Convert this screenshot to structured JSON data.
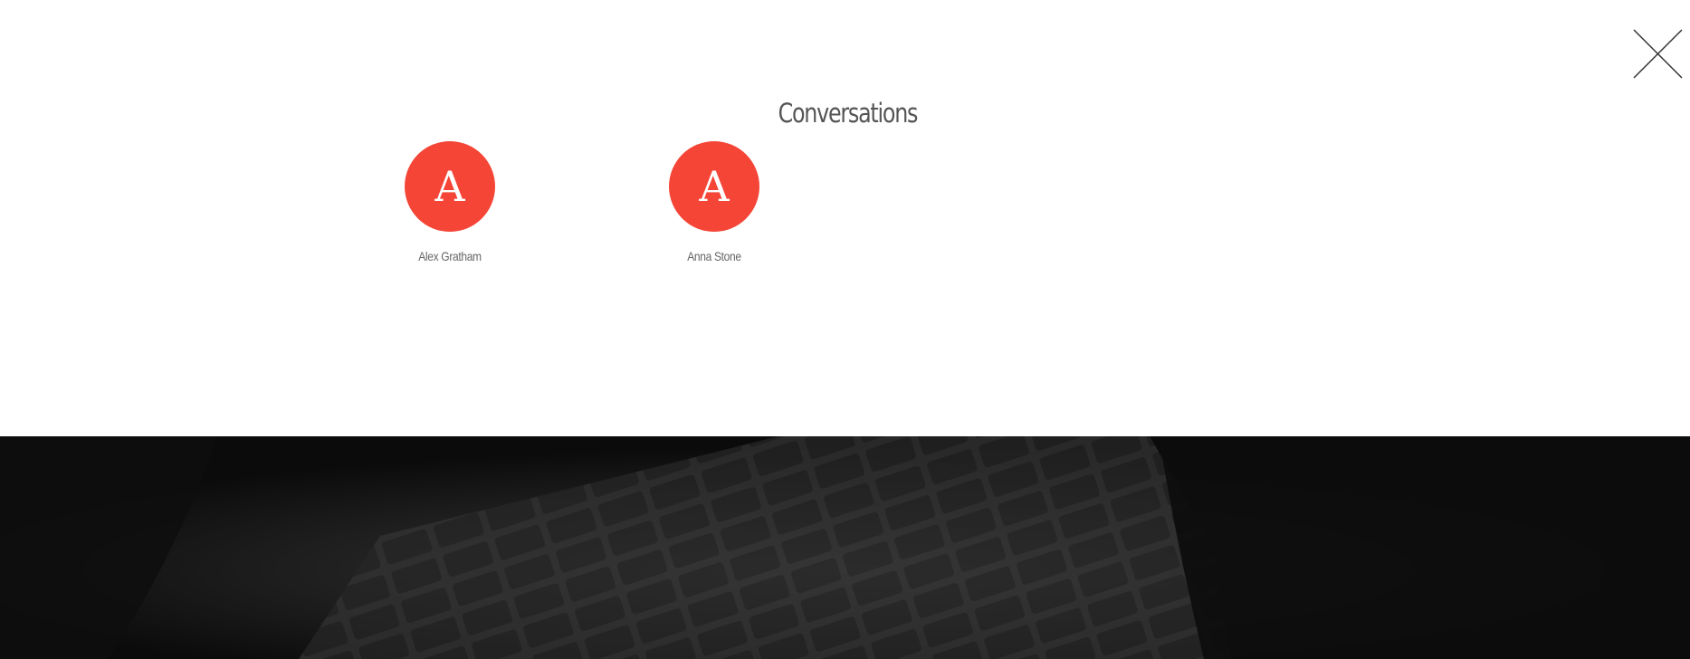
{
  "dialog": {
    "title": "Conversations",
    "close_icon": "close-icon"
  },
  "contacts": [
    {
      "initial": "A",
      "name": "Alex Gratham"
    },
    {
      "initial": "A",
      "name": "Anna Stone"
    }
  ],
  "colors": {
    "avatar_bg": "#f44536",
    "title_text": "#555555",
    "name_text": "#666666",
    "background_photo": "#0d0d0d"
  }
}
